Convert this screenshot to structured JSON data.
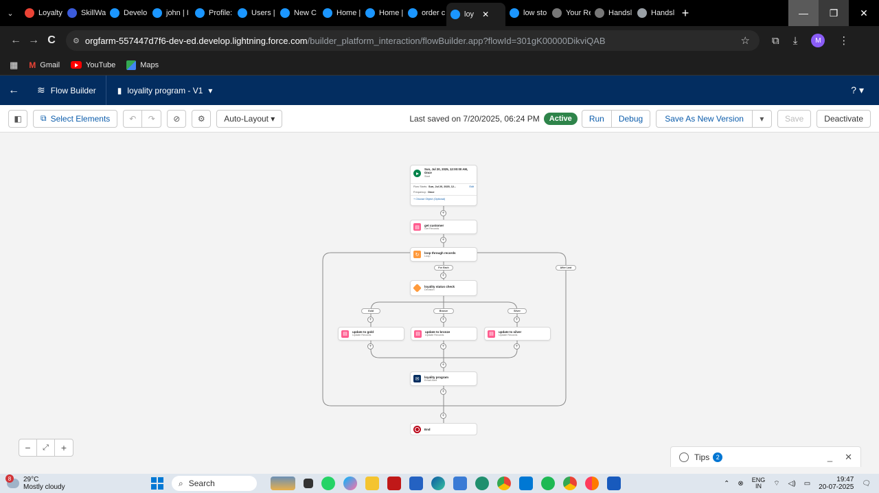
{
  "browser": {
    "tabs": [
      {
        "label": "Loyalty",
        "color": "#ea4335"
      },
      {
        "label": "SkillWa",
        "color": "#3b5bdb"
      },
      {
        "label": "Develo",
        "color": "#1b96ff"
      },
      {
        "label": "john | I",
        "color": "#1b96ff"
      },
      {
        "label": "Profile:",
        "color": "#1b96ff"
      },
      {
        "label": "Users |",
        "color": "#1b96ff"
      },
      {
        "label": "New C",
        "color": "#1b96ff"
      },
      {
        "label": "Home |",
        "color": "#1b96ff"
      },
      {
        "label": "Home |",
        "color": "#1b96ff"
      },
      {
        "label": "order c",
        "color": "#1b96ff"
      },
      {
        "label": "loy",
        "color": "#1b96ff",
        "active": true
      },
      {
        "label": "low sto",
        "color": "#1b96ff"
      },
      {
        "label": "Your Re",
        "color": "#777777"
      },
      {
        "label": "Handsl",
        "color": "#777777"
      },
      {
        "label": "Handsl",
        "color": "#9aa0a6"
      }
    ],
    "url_host": "orgfarm-557447d7f6-dev-ed.develop.lightning.force.com",
    "url_path": "/builder_platform_interaction/flowBuilder.app?flowId=301gK00000DikviQAB",
    "profile_initial": "M",
    "bookmarks": [
      "Gmail",
      "YouTube",
      "Maps"
    ]
  },
  "sf": {
    "app_name": "Flow Builder",
    "flow_name": "loyality program - V1",
    "help": "?"
  },
  "toolbar": {
    "select_elements": "Select Elements",
    "layout": "Auto-Layout",
    "last_saved": "Last saved on 7/20/2025, 06:24 PM",
    "status": "Active",
    "run": "Run",
    "debug": "Debug",
    "save_as_new": "Save As New Version",
    "save": "Save",
    "deactivate": "Deactivate"
  },
  "flow": {
    "start": {
      "title": "Sun, Jul 20, 2025, 12:00:00 AM, Once",
      "subtitle": "Start",
      "row1_label": "Flow Starts:",
      "row1_value": "Sun, Jul 20, 2025, 12...",
      "row1_action": "Edit",
      "row2_label": "Frequency:",
      "row2_value": "Once",
      "choose": "+ Choose Object (Optional)"
    },
    "get_records": {
      "title": "get customer",
      "subtitle": "Get Records",
      "color": "#ff5d8f"
    },
    "loop": {
      "title": "loop through records",
      "subtitle": "Loop",
      "color": "#ff9a3c"
    },
    "for_each": "For Each",
    "after_last": "After Last",
    "decision": {
      "title": "loyality status check",
      "subtitle": "Decision",
      "color": "#ff9a3c"
    },
    "outcomes": [
      "Gold",
      "Bronze",
      "Silver"
    ],
    "updates": [
      {
        "title": "update to gold",
        "subtitle": "Update Records"
      },
      {
        "title": "update to bronze",
        "subtitle": "Update Records"
      },
      {
        "title": "update to silver",
        "subtitle": "Update Records"
      }
    ],
    "email": {
      "title": "loyality program",
      "subtitle": "Email Alert",
      "color": "#032d60"
    },
    "end": "End"
  },
  "tips": {
    "label": "Tips",
    "count": "2"
  },
  "taskbar": {
    "weather_badge": "8",
    "temp": "29°C",
    "condition": "Mostly cloudy",
    "search": "Search",
    "lang1": "ENG",
    "lang2": "IN",
    "time": "19:47",
    "date": "20-07-2025"
  }
}
